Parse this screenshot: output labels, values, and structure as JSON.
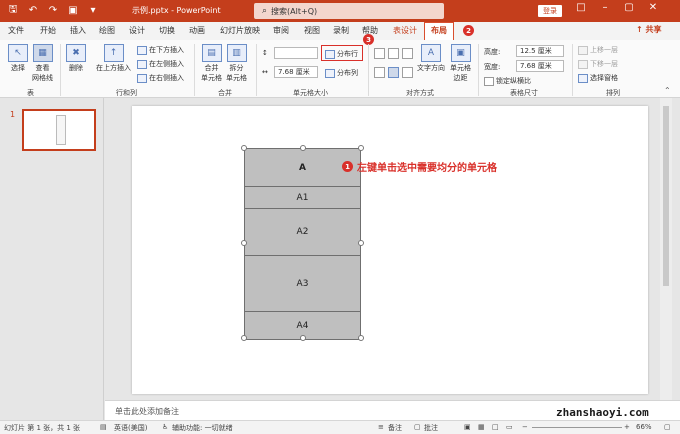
{
  "titlebar": {
    "doc_title": "示例.pptx  -  PowerPoint",
    "search_placeholder": "搜索(Alt+Q)",
    "login": "登录",
    "accent": "#c43e1c"
  },
  "tabs": [
    "文件",
    "开始",
    "插入",
    "绘图",
    "设计",
    "切换",
    "动画",
    "幻灯片放映",
    "审阅",
    "视图",
    "录制",
    "帮助",
    "表设计",
    "布局"
  ],
  "share": "共享",
  "badges": {
    "b1": "1",
    "b2": "2",
    "b3": "3"
  },
  "ribbon": {
    "select": "选择",
    "view_gridlines": "查看\n网格线",
    "table_group": "表",
    "delete": "删除",
    "insert_above": "在上方插入",
    "insert_below": "在下方插入",
    "insert_left": "在左侧插入",
    "insert_right": "在右侧插入",
    "rows_cols_group": "行和列",
    "merge": "合并\n单元格",
    "split": "拆分\n单元格",
    "merge_group": "合并",
    "height_value": "",
    "width_value": "7.68 厘米",
    "distribute_rows": "分布行",
    "distribute_cols": "分布列",
    "cell_size_group": "单元格大小",
    "text_direction": "文字方向",
    "cell_margins": "单元格\n边距",
    "alignment_group": "对齐方式",
    "table_height_label": "高度:",
    "table_height": "12.5 厘米",
    "table_width_label": "宽度:",
    "table_width": "7.68 厘米",
    "lock_ratio": "锁定纵横比",
    "table_size_group": "表格尺寸",
    "bring_forward": "上移一层",
    "send_backward": "下移一层",
    "selection_pane": "选择窗格",
    "arrange_group": "排列"
  },
  "thumbnail": {
    "number": "1"
  },
  "table_rows": [
    "A",
    "A1",
    "A2",
    "A3",
    "A4"
  ],
  "annotation": "左键单击选中需要均分的单元格",
  "notes_placeholder": "单击此处添加备注",
  "statusbar": {
    "slide_info": "幻灯片 第 1 张，共 1 张",
    "language": "英语(美国)",
    "accessibility": "辅助功能: 一切就绪",
    "notes": "备注",
    "comments": "批注",
    "zoom": "66%"
  },
  "watermark": "zhanshaoyi.com"
}
